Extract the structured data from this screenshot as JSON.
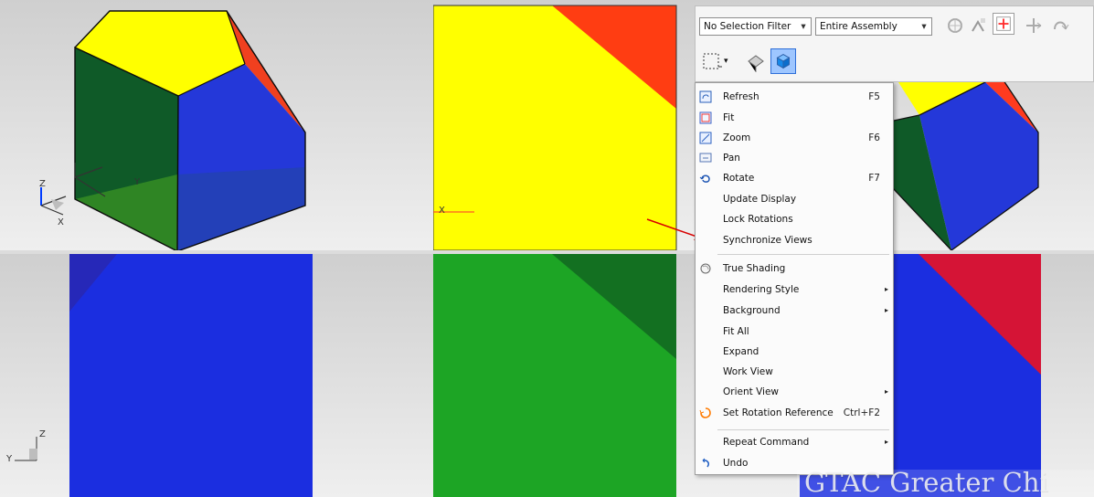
{
  "toolbar": {
    "selection_filter": "No Selection Filter",
    "assembly_scope": "Entire Assembly",
    "icons": [
      "selection-filter-icon",
      "assembly-icon",
      "snap-icon",
      "point-icon",
      "move-icon",
      "redo-icon",
      "box-select-icon",
      "shaded-icon",
      "view-icon"
    ]
  },
  "context_menu": {
    "items": [
      {
        "label": "Refresh",
        "shortcut": "F5",
        "icon": "refresh-icon"
      },
      {
        "label": "Fit",
        "shortcut": "",
        "icon": "fit-icon"
      },
      {
        "label": "Zoom",
        "shortcut": "F6",
        "icon": "zoom-icon"
      },
      {
        "label": "Pan",
        "shortcut": "",
        "icon": "pan-icon"
      },
      {
        "label": "Rotate",
        "shortcut": "F7",
        "icon": "rotate-icon"
      },
      {
        "label": "Update Display",
        "shortcut": "",
        "icon": ""
      },
      {
        "label": "Lock Rotations",
        "shortcut": "",
        "icon": ""
      },
      {
        "label": "Synchronize Views",
        "shortcut": "",
        "icon": ""
      },
      {
        "label": "True Shading",
        "shortcut": "",
        "icon": "true-shading-icon"
      },
      {
        "label": "Rendering Style",
        "shortcut": "",
        "icon": "",
        "submenu": true
      },
      {
        "label": "Background",
        "shortcut": "",
        "icon": "",
        "submenu": true
      },
      {
        "label": "Fit All",
        "shortcut": "",
        "icon": ""
      },
      {
        "label": "Expand",
        "shortcut": "",
        "icon": ""
      },
      {
        "label": "Work View",
        "shortcut": "",
        "icon": ""
      },
      {
        "label": "Orient View",
        "shortcut": "",
        "icon": "",
        "submenu": true
      },
      {
        "label": "Set Rotation Reference",
        "shortcut": "Ctrl+F2",
        "icon": "rotation-reference-icon"
      },
      {
        "label": "Repeat Command",
        "shortcut": "",
        "icon": "",
        "submenu": true
      },
      {
        "label": "Undo",
        "shortcut": "",
        "icon": "undo-icon"
      }
    ],
    "submenu_marker": "▸"
  },
  "axis_labels": {
    "x": "X",
    "y": "Y",
    "z": "Z"
  },
  "watermark": "GTAC Greater Chi",
  "colors": {
    "yellow": "#ffff00",
    "red": "#ff3b1f",
    "green": "#1d9f2a",
    "dark_green": "#0f5a28",
    "blue": "#1b2ee0",
    "dark_blue": "#1638b8"
  }
}
